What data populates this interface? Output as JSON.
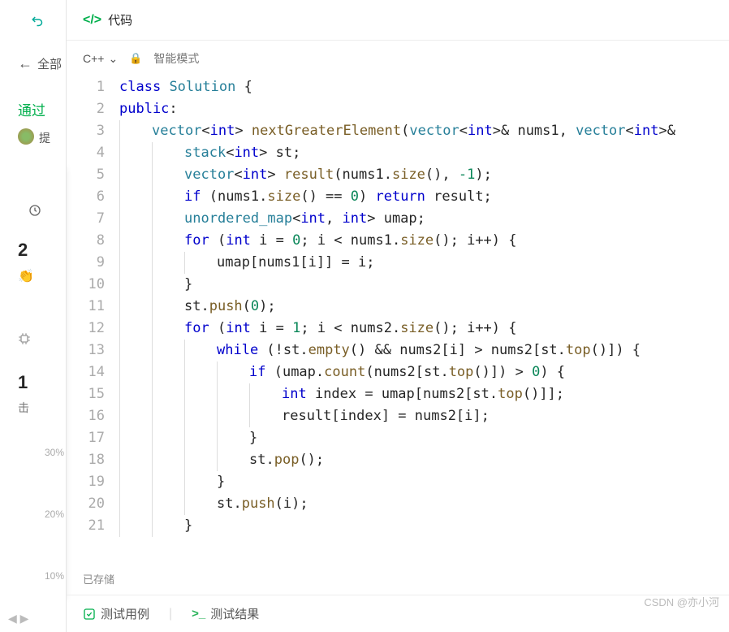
{
  "left": {
    "back_text": "全部",
    "pass": "通过",
    "sub_text": "提",
    "stat1": "2",
    "stat2": "1",
    "stat2_sub": "击",
    "pct30": "30%",
    "pct20": "20%",
    "pct10": "10%"
  },
  "header": {
    "title": "代码"
  },
  "toolbar": {
    "language": "C++",
    "mode": "智能模式"
  },
  "code_lines": [
    {
      "n": 1,
      "indent": 0,
      "tokens": [
        [
          "kw",
          "class"
        ],
        [
          "",
          " "
        ],
        [
          "clsname",
          "Solution"
        ],
        [
          "",
          " {"
        ]
      ]
    },
    {
      "n": 2,
      "indent": 0,
      "tokens": [
        [
          "pub",
          "public"
        ],
        [
          "",
          ":"
        ]
      ]
    },
    {
      "n": 3,
      "indent": 1,
      "tokens": [
        [
          "type",
          "vector"
        ],
        [
          "",
          "<"
        ],
        [
          "kw",
          "int"
        ],
        [
          "",
          "> "
        ],
        [
          "fn",
          "nextGreaterElement"
        ],
        [
          "",
          "("
        ],
        [
          "type",
          "vector"
        ],
        [
          "",
          "<"
        ],
        [
          "kw",
          "int"
        ],
        [
          "",
          ">& nums1, "
        ],
        [
          "type",
          "vector"
        ],
        [
          "",
          "<"
        ],
        [
          "kw",
          "int"
        ],
        [
          "",
          ">&"
        ]
      ]
    },
    {
      "n": 4,
      "indent": 2,
      "tokens": [
        [
          "type",
          "stack"
        ],
        [
          "",
          "<"
        ],
        [
          "kw",
          "int"
        ],
        [
          "",
          "> st;"
        ]
      ]
    },
    {
      "n": 5,
      "indent": 2,
      "tokens": [
        [
          "type",
          "vector"
        ],
        [
          "",
          "<"
        ],
        [
          "kw",
          "int"
        ],
        [
          "",
          "> "
        ],
        [
          "fn",
          "result"
        ],
        [
          "",
          "(nums1."
        ],
        [
          "fn",
          "size"
        ],
        [
          "",
          "(), "
        ],
        [
          "num",
          "-1"
        ],
        [
          "",
          ");"
        ]
      ]
    },
    {
      "n": 6,
      "indent": 2,
      "tokens": [
        [
          "kw",
          "if"
        ],
        [
          "",
          " (nums1."
        ],
        [
          "fn",
          "size"
        ],
        [
          "",
          "() == "
        ],
        [
          "num",
          "0"
        ],
        [
          "",
          ") "
        ],
        [
          "kw",
          "return"
        ],
        [
          "",
          " result;"
        ]
      ]
    },
    {
      "n": 7,
      "indent": 2,
      "tokens": [
        [
          "type",
          "unordered_map"
        ],
        [
          "",
          "<"
        ],
        [
          "kw",
          "int"
        ],
        [
          "",
          ", "
        ],
        [
          "kw",
          "int"
        ],
        [
          "",
          "> umap;"
        ]
      ]
    },
    {
      "n": 8,
      "indent": 2,
      "tokens": [
        [
          "kw",
          "for"
        ],
        [
          "",
          " ("
        ],
        [
          "kw",
          "int"
        ],
        [
          "",
          " i = "
        ],
        [
          "num",
          "0"
        ],
        [
          "",
          "; i < nums1."
        ],
        [
          "fn",
          "size"
        ],
        [
          "",
          "(); i++) {"
        ]
      ]
    },
    {
      "n": 9,
      "indent": 3,
      "tokens": [
        [
          "",
          "umap[nums1[i]] = i;"
        ]
      ]
    },
    {
      "n": 10,
      "indent": 2,
      "tokens": [
        [
          "",
          "}"
        ]
      ]
    },
    {
      "n": 11,
      "indent": 2,
      "tokens": [
        [
          "",
          "st."
        ],
        [
          "fn",
          "push"
        ],
        [
          "",
          "("
        ],
        [
          "num",
          "0"
        ],
        [
          "",
          ");"
        ]
      ]
    },
    {
      "n": 12,
      "indent": 2,
      "tokens": [
        [
          "kw",
          "for"
        ],
        [
          "",
          " ("
        ],
        [
          "kw",
          "int"
        ],
        [
          "",
          " i = "
        ],
        [
          "num",
          "1"
        ],
        [
          "",
          "; i < nums2."
        ],
        [
          "fn",
          "size"
        ],
        [
          "",
          "(); i++) {"
        ]
      ]
    },
    {
      "n": 13,
      "indent": 3,
      "tokens": [
        [
          "kw",
          "while"
        ],
        [
          "",
          " (!st."
        ],
        [
          "fn",
          "empty"
        ],
        [
          "",
          "() && nums2[i] > nums2[st."
        ],
        [
          "fn",
          "top"
        ],
        [
          "",
          "()]) {"
        ]
      ]
    },
    {
      "n": 14,
      "indent": 4,
      "tokens": [
        [
          "kw",
          "if"
        ],
        [
          "",
          " (umap."
        ],
        [
          "fn",
          "count"
        ],
        [
          "",
          "(nums2[st."
        ],
        [
          "fn",
          "top"
        ],
        [
          "",
          "()]) > "
        ],
        [
          "num",
          "0"
        ],
        [
          "",
          ") {"
        ]
      ]
    },
    {
      "n": 15,
      "indent": 5,
      "tokens": [
        [
          "kw",
          "int"
        ],
        [
          "",
          " index = umap[nums2[st."
        ],
        [
          "fn",
          "top"
        ],
        [
          "",
          "()]];"
        ]
      ]
    },
    {
      "n": 16,
      "indent": 5,
      "tokens": [
        [
          "",
          "result[index] = nums2[i];"
        ]
      ]
    },
    {
      "n": 17,
      "indent": 4,
      "tokens": [
        [
          "",
          "}"
        ]
      ]
    },
    {
      "n": 18,
      "indent": 4,
      "tokens": [
        [
          "",
          "st."
        ],
        [
          "fn",
          "pop"
        ],
        [
          "",
          "();"
        ]
      ]
    },
    {
      "n": 19,
      "indent": 3,
      "tokens": [
        [
          "",
          "}"
        ]
      ]
    },
    {
      "n": 20,
      "indent": 3,
      "tokens": [
        [
          "",
          "st."
        ],
        [
          "fn",
          "push"
        ],
        [
          "",
          "(i);"
        ]
      ]
    },
    {
      "n": 21,
      "indent": 2,
      "tokens": [
        [
          "",
          "}"
        ]
      ]
    }
  ],
  "saved": "已存储",
  "bottom": {
    "tab1": "测试用例",
    "tab2": "测试结果"
  },
  "watermark": "CSDN @亦小河"
}
